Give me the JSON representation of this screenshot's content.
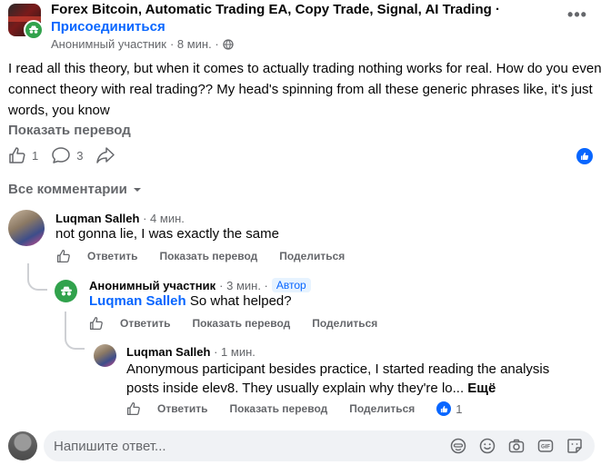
{
  "post": {
    "group_name": "Forex Bitcoin, Automatic Trading EA, Copy Trade, Signal, AI Trading ·",
    "join_label": "Присоединиться",
    "author": "Анонимный участник",
    "time": "· 8 мин. ·",
    "text": "I read all this theory, but when it comes to actually trading nothing works for real. How do you even connect theory with real trading?? My head's spinning from all these generic phrases like, it's just words, you know",
    "translate_label": "Показать перевод",
    "like_count": "1",
    "comment_count": "3"
  },
  "comments_filter": "Все комментарии",
  "comments": [
    {
      "author": "Luqman Salleh",
      "time": "· 4 мин.",
      "text": "not gonna lie, I was exactly the same",
      "reply_label": "Ответить",
      "translate_label": "Показать перевод",
      "share_label": "Поделиться"
    },
    {
      "author": "Анонимный участник",
      "time": "· 3 мин. ·",
      "badge": "Автор",
      "mention": "Luqman Salleh",
      "text": " So what helped?",
      "reply_label": "Ответить",
      "translate_label": "Показать перевод",
      "share_label": "Поделиться"
    },
    {
      "author": "Luqman Salleh",
      "time": "· 1 мин.",
      "text": "Anonymous participant besides practice, I started reading the analysis posts inside elev8. They usually explain why they're lo...",
      "more_label": "Ещё",
      "reply_label": "Ответить",
      "translate_label": "Показать перевод",
      "share_label": "Поделиться",
      "like_count": "1"
    }
  ],
  "composer": {
    "placeholder": "Напишите ответ..."
  },
  "colors": {
    "accent": "#0866ff",
    "anon_green": "#31a24c",
    "secondary_text": "#65676b",
    "composer_bg": "#f0f2f5"
  },
  "icons": [
    "more-icon",
    "globe-icon",
    "like-icon",
    "comment-icon",
    "share-icon",
    "chevron-down-icon",
    "avatar-icon",
    "gif-icon",
    "camera-icon",
    "emoji-icon",
    "sticker-icon"
  ]
}
